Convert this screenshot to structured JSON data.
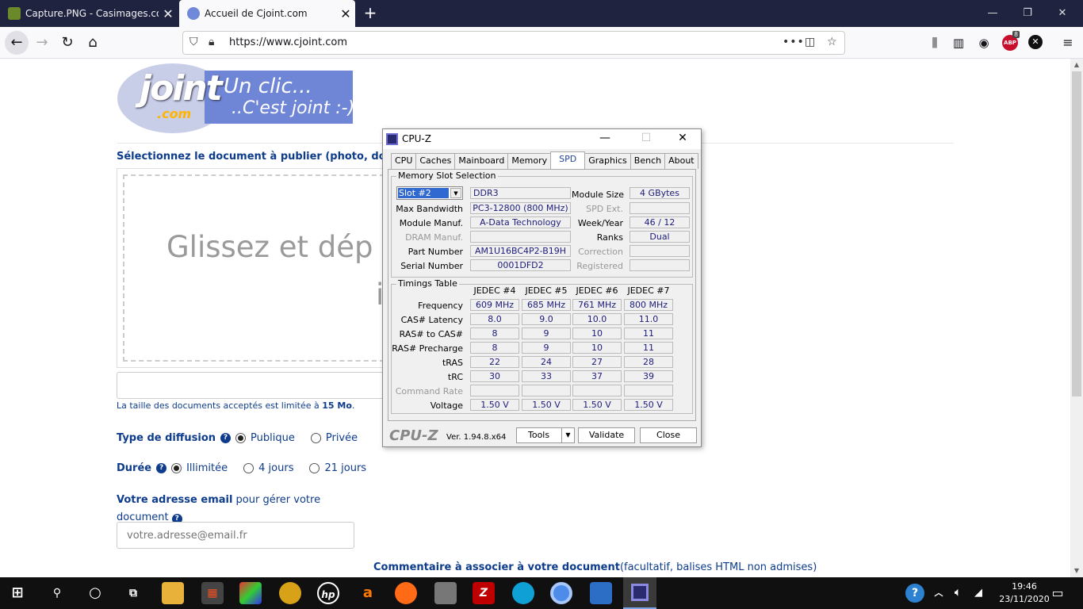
{
  "browser": {
    "tabs": [
      {
        "title": "Capture.PNG - Casimages.com",
        "icon": "casimages-favicon"
      },
      {
        "title": "Accueil de Cjoint.com",
        "icon": "cjoint-favicon",
        "active": true
      }
    ],
    "url": "https://www.cjoint.com",
    "badge_count": "8",
    "abp_label": "ABP"
  },
  "page": {
    "logo": {
      "word": "joint",
      "com": ".com",
      "tag1": "Un clic...",
      "tag2": "..C'est joint :-)"
    },
    "select_title": "Sélectionnez le document à publier (photo, document",
    "drop_text": "Glissez et dép",
    "drop_char": "i",
    "size_note_prefix": "La taille des documents acceptés est limitée à ",
    "size_note_value": "15 Mo",
    "size_note_suffix": ".",
    "diffusion": {
      "label": "Type de diffusion",
      "options": [
        "Publique",
        "Privée"
      ],
      "selected": "Publique"
    },
    "duree": {
      "label": "Durée",
      "options": [
        "Illimitée",
        "4 jours",
        "21 jours"
      ],
      "selected": "Illimitée"
    },
    "email": {
      "label_bold": "Votre adresse email",
      "label_rest": " pour gérer votre",
      "label_line2": "document",
      "placeholder": "votre.adresse@email.fr"
    },
    "comment": {
      "label_bold": "Commentaire à associer à votre document",
      "label_rest": "(facultatif, balises HTML non admises)"
    }
  },
  "cpuz": {
    "title": "CPU-Z",
    "tabs": [
      "CPU",
      "Caches",
      "Mainboard",
      "Memory",
      "SPD",
      "Graphics",
      "Bench",
      "About"
    ],
    "active_tab": "SPD",
    "slot_group": "Memory Slot Selection",
    "slot": "Slot #2",
    "type": "DDR3",
    "module_size_label": "Module Size",
    "module_size": "4 GBytes",
    "max_bandwidth_label": "Max Bandwidth",
    "max_bandwidth": "PC3-12800 (800 MHz)",
    "spd_ext_label": "SPD Ext.",
    "spd_ext": "",
    "module_manuf_label": "Module Manuf.",
    "module_manuf": "A-Data Technology",
    "week_year_label": "Week/Year",
    "week_year": "46 / 12",
    "dram_manuf_label": "DRAM Manuf.",
    "dram_manuf": "",
    "ranks_label": "Ranks",
    "ranks": "Dual",
    "part_number_label": "Part Number",
    "part_number": "AM1U16BC4P2-B19H",
    "correction_label": "Correction",
    "correction": "",
    "serial_number_label": "Serial Number",
    "serial_number": "0001DFD2",
    "registered_label": "Registered",
    "registered": "",
    "timings_group": "Timings Table",
    "timing_columns": [
      "JEDEC #4",
      "JEDEC #5",
      "JEDEC #6",
      "JEDEC #7"
    ],
    "timing_rows": [
      {
        "label": "Frequency",
        "values": [
          "609 MHz",
          "685 MHz",
          "761 MHz",
          "800 MHz"
        ]
      },
      {
        "label": "CAS# Latency",
        "values": [
          "8.0",
          "9.0",
          "10.0",
          "11.0"
        ]
      },
      {
        "label": "RAS# to CAS#",
        "values": [
          "8",
          "9",
          "10",
          "11"
        ]
      },
      {
        "label": "RAS# Precharge",
        "values": [
          "8",
          "9",
          "10",
          "11"
        ]
      },
      {
        "label": "tRAS",
        "values": [
          "22",
          "24",
          "27",
          "28"
        ]
      },
      {
        "label": "tRC",
        "values": [
          "30",
          "33",
          "37",
          "39"
        ]
      },
      {
        "label": "Command Rate",
        "values": [
          "",
          "",
          "",
          ""
        ],
        "dim": true
      },
      {
        "label": "Voltage",
        "values": [
          "1.50 V",
          "1.50 V",
          "1.50 V",
          "1.50 V"
        ]
      }
    ],
    "brand": "CPU-Z",
    "version": "Ver. 1.94.8.x64",
    "tools_label": "Tools",
    "validate_label": "Validate",
    "close_label": "Close"
  },
  "taskbar": {
    "time": "19:46",
    "date": "23/11/2020",
    "apps": [
      "windows-start",
      "search",
      "cortana",
      "task-view",
      "file-explorer",
      "store",
      "paint-app",
      "game-app",
      "hp-app",
      "avast-app",
      "firefox",
      "installer-app",
      "filezilla",
      "edge",
      "chromium",
      "outlook",
      "cpuz-app"
    ]
  }
}
